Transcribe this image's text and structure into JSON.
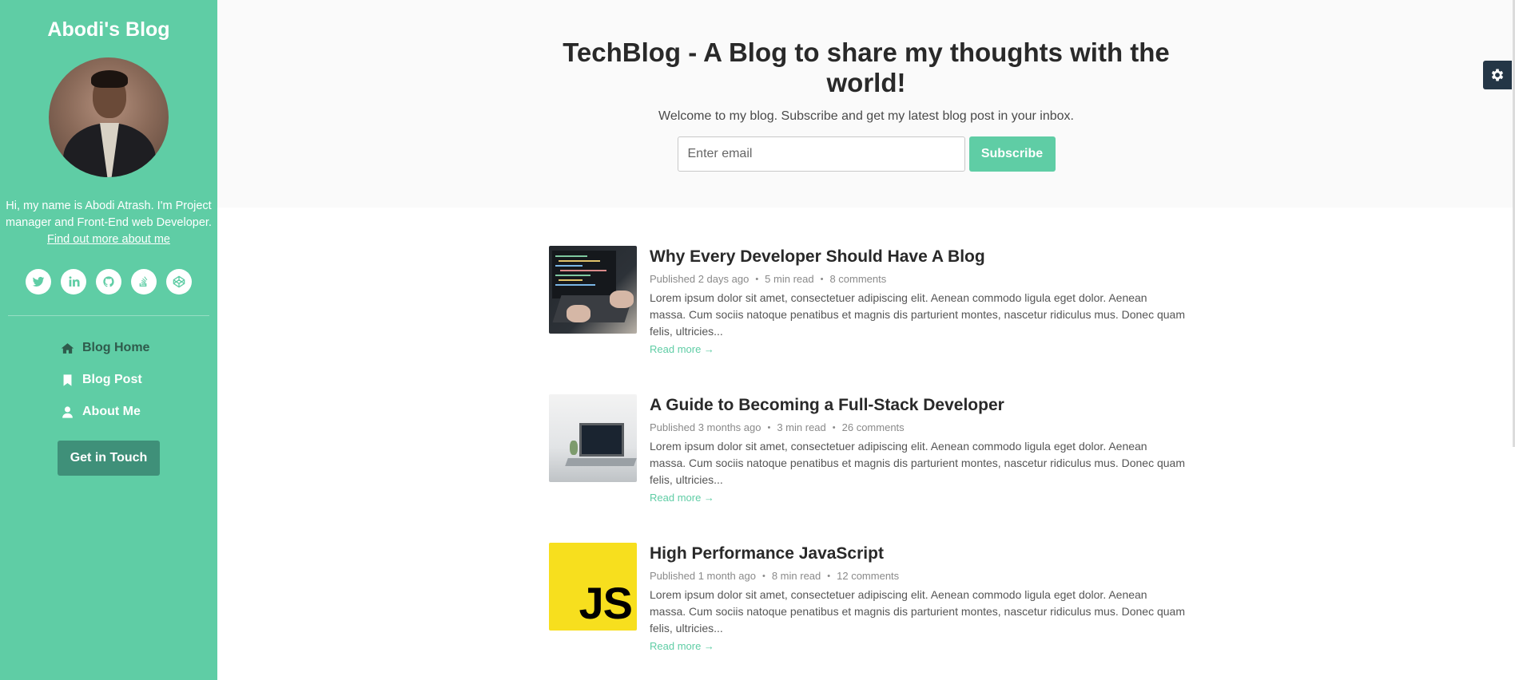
{
  "sidebar": {
    "blog_name": "Abodi's Blog",
    "bio": "Hi, my name is Abodi Atrash. I'm Project manager and Front-End web Developer.",
    "bio_link": "Find out more about me",
    "socials": [
      "twitter-icon",
      "linkedin-icon",
      "github-icon",
      "stack-overflow-icon",
      "codepen-icon"
    ],
    "nav": [
      {
        "label": "Blog Home",
        "icon": "home-icon"
      },
      {
        "label": "Blog Post",
        "icon": "bookmark-icon"
      },
      {
        "label": "About Me",
        "icon": "user-icon"
      }
    ],
    "cta": "Get in Touch"
  },
  "header": {
    "title": "TechBlog - A Blog to share my thoughts with the world!",
    "subtitle": "Welcome to my blog. Subscribe and get my latest blog post in your inbox.",
    "email_placeholder": "Enter email",
    "subscribe_label": "Subscribe"
  },
  "posts": [
    {
      "title": "Why Every Developer Should Have A Blog",
      "published": "Published 2 days ago",
      "read_time": "5 min read",
      "comments": "8 comments",
      "excerpt": "Lorem ipsum dolor sit amet, consectetuer adipiscing elit. Aenean commodo ligula eget dolor. Aenean massa. Cum sociis natoque penatibus et magnis dis parturient montes, nascetur ridiculus mus. Donec quam felis, ultricies...",
      "more": "Read more →"
    },
    {
      "title": "A Guide to Becoming a Full-Stack Developer",
      "published": "Published 3 months ago",
      "read_time": "3 min read",
      "comments": "26 comments",
      "excerpt": "Lorem ipsum dolor sit amet, consectetuer adipiscing elit. Aenean commodo ligula eget dolor. Aenean massa. Cum sociis natoque penatibus et magnis dis parturient montes, nascetur ridiculus mus. Donec quam felis, ultricies...",
      "more": "Read more →"
    },
    {
      "title": "High Performance JavaScript",
      "published": "Published 1 month ago",
      "read_time": "8 min read",
      "comments": "12 comments",
      "excerpt": "Lorem ipsum dolor sit amet, consectetuer adipiscing elit. Aenean commodo ligula eget dolor. Aenean massa. Cum sociis natoque penatibus et magnis dis parturient montes, nascetur ridiculus mus. Donec quam felis, ultricies...",
      "more": "Read more →",
      "thumb_text": "JS"
    }
  ],
  "meta_separator": "•",
  "colors": {
    "accent": "#5fcda5",
    "cta": "#3f9079",
    "settings": "#243646"
  }
}
